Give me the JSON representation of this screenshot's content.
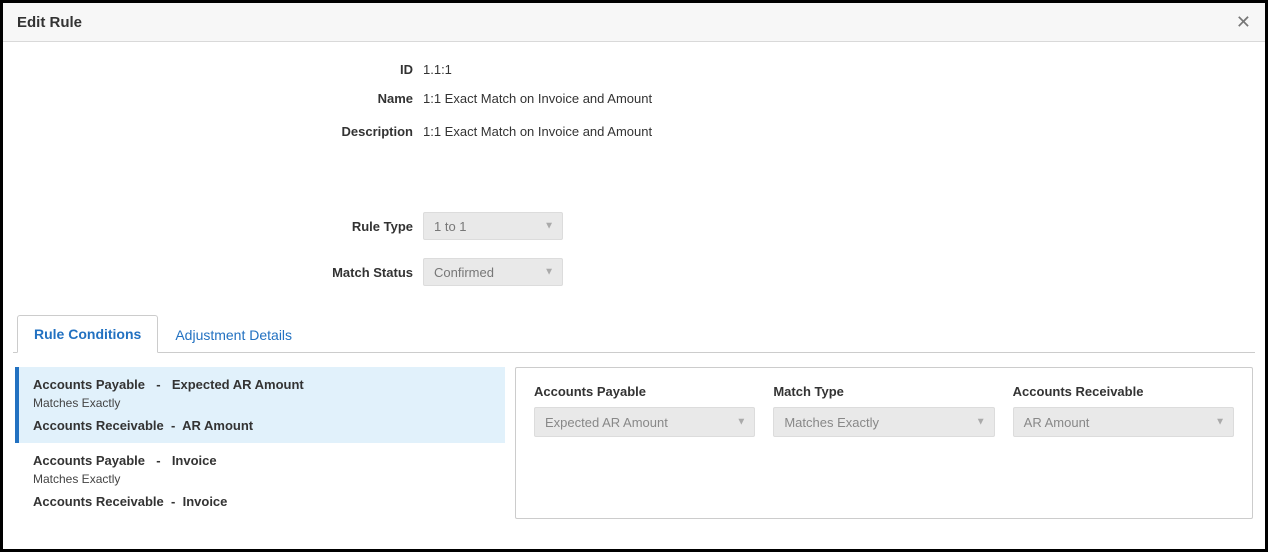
{
  "dialog": {
    "title": "Edit Rule"
  },
  "form": {
    "id_label": "ID",
    "id_value": "1.1:1",
    "name_label": "Name",
    "name_value": "1:1 Exact Match on Invoice and Amount",
    "description_label": "Description",
    "description_value": "1:1 Exact Match on Invoice and Amount",
    "rule_type_label": "Rule Type",
    "rule_type_value": "1 to 1",
    "match_status_label": "Match Status",
    "match_status_value": "Confirmed"
  },
  "tabs": {
    "conditions": "Rule Conditions",
    "adjustment": "Adjustment Details"
  },
  "conditions": [
    {
      "source1": "Accounts Payable",
      "field1": "Expected AR Amount",
      "match": "Matches Exactly",
      "source2": "Accounts Receivable",
      "field2": "AR Amount"
    },
    {
      "source1": "Accounts Payable",
      "field1": "Invoice",
      "match": "Matches Exactly",
      "source2": "Accounts Receivable",
      "field2": "Invoice"
    }
  ],
  "detail": {
    "col1_label": "Accounts Payable",
    "col1_value": "Expected AR Amount",
    "col2_label": "Match Type",
    "col2_value": "Matches Exactly",
    "col3_label": "Accounts Receivable",
    "col3_value": "AR Amount"
  },
  "sep": "-"
}
